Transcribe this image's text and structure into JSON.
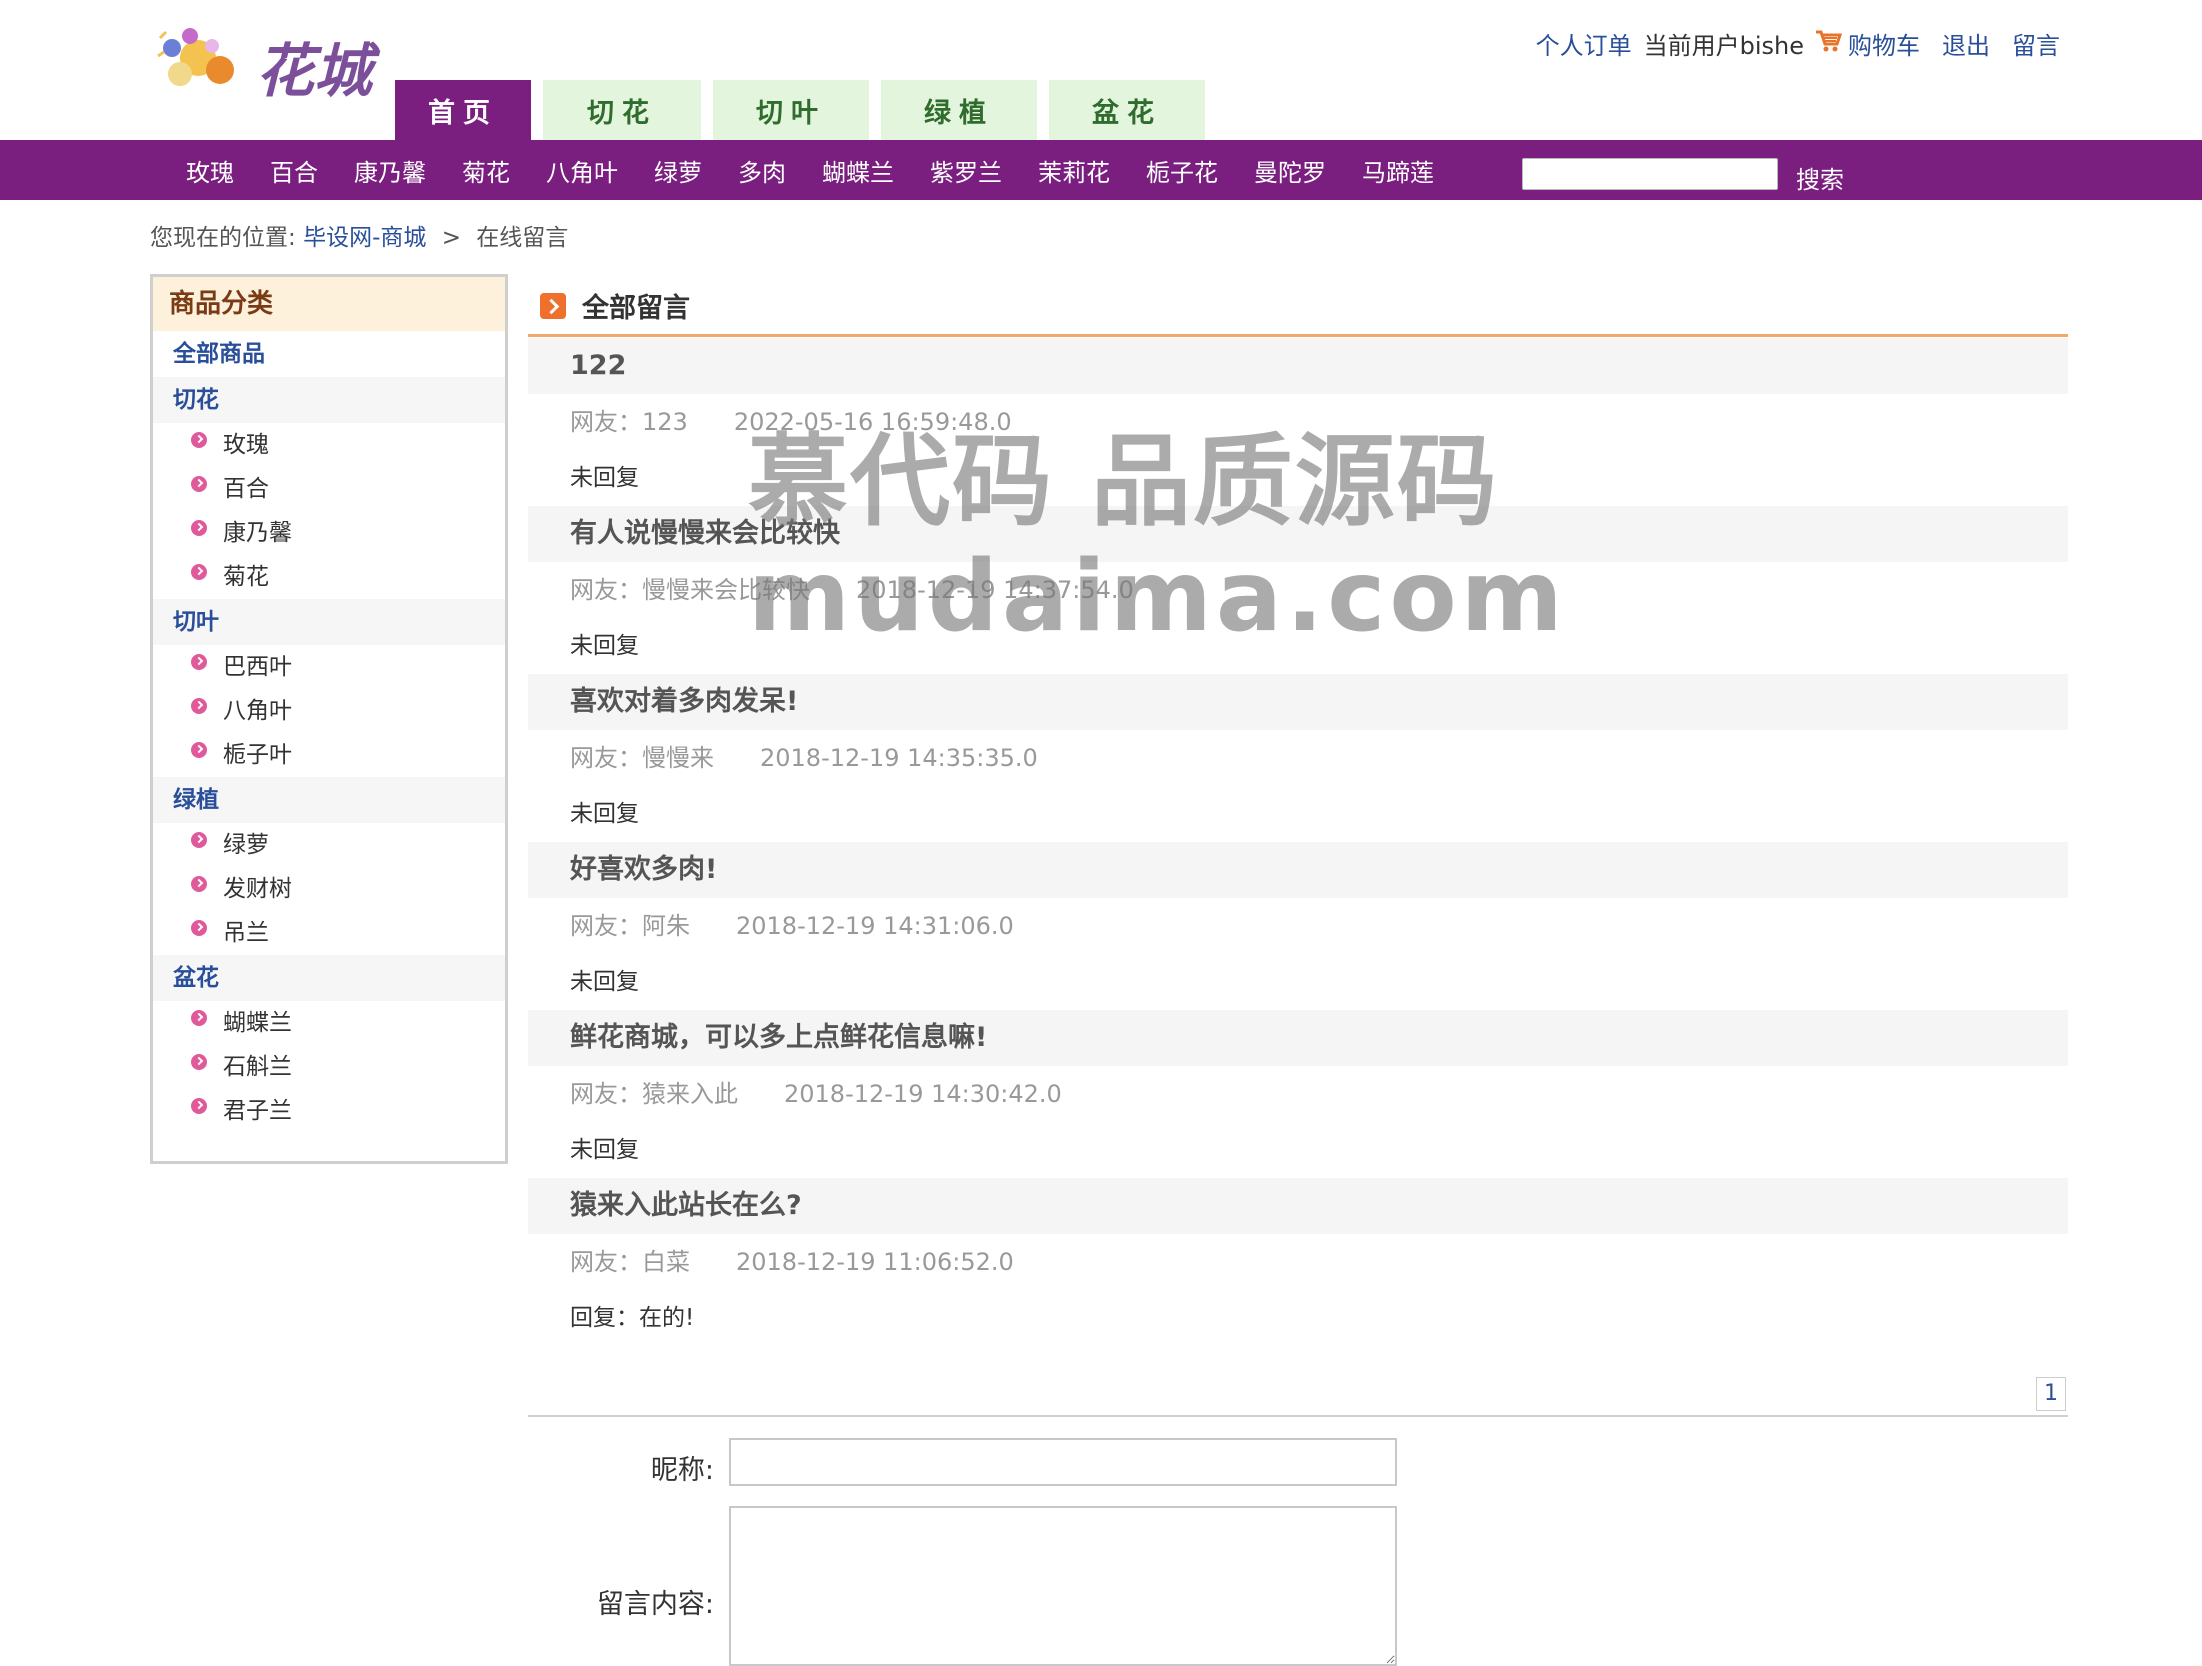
{
  "header": {
    "logo_text": "花城",
    "top_links": {
      "orders": "个人订单",
      "current_user": "当前用户bishe",
      "cart": "购物车",
      "logout": "退出",
      "message": "留言"
    },
    "main_tabs": [
      {
        "label": "首页",
        "active": true
      },
      {
        "label": "切花",
        "active": false
      },
      {
        "label": "切叶",
        "active": false
      },
      {
        "label": "绿植",
        "active": false
      },
      {
        "label": "盆花",
        "active": false
      }
    ],
    "sub_nav": [
      "玫瑰",
      "百合",
      "康乃馨",
      "菊花",
      "八角叶",
      "绿萝",
      "多肉",
      "蝴蝶兰",
      "紫罗兰",
      "茉莉花",
      "栀子花",
      "曼陀罗",
      "马蹄莲"
    ],
    "search": {
      "value": "",
      "button": "搜索"
    }
  },
  "breadcrumb": {
    "prefix": "您现在的位置:",
    "link": "毕设网-商城",
    "separator": ">",
    "current": "在线留言"
  },
  "sidebar": {
    "title": "商品分类",
    "all": "全部商品",
    "categories": [
      {
        "name": "切花",
        "items": [
          "玫瑰",
          "百合",
          "康乃馨",
          "菊花"
        ]
      },
      {
        "name": "切叶",
        "items": [
          "巴西叶",
          "八角叶",
          "栀子叶"
        ]
      },
      {
        "name": "绿植",
        "items": [
          "绿萝",
          "发财树",
          "吊兰"
        ]
      },
      {
        "name": "盆花",
        "items": [
          "蝴蝶兰",
          "石斛兰",
          "君子兰"
        ]
      }
    ]
  },
  "main": {
    "section_title": "全部留言",
    "messages": [
      {
        "title": "122",
        "author": "网友：123",
        "date": "2022-05-16 16:59:48.0",
        "reply": "未回复"
      },
      {
        "title": "有人说慢慢来会比较快",
        "author": "网友：慢慢来会比较快",
        "date": "2018-12-19 14:37:54.0",
        "reply": "未回复"
      },
      {
        "title": "喜欢对着多肉发呆!",
        "author": "网友：慢慢来",
        "date": "2018-12-19 14:35:35.0",
        "reply": "未回复"
      },
      {
        "title": "好喜欢多肉!",
        "author": "网友：阿朱",
        "date": "2018-12-19 14:31:06.0",
        "reply": "未回复"
      },
      {
        "title": "鲜花商城，可以多上点鲜花信息嘛!",
        "author": "网友：猿来入此",
        "date": "2018-12-19 14:30:42.0",
        "reply": "未回复"
      },
      {
        "title": "猿来入此站长在么?",
        "author": "网友：白菜",
        "date": "2018-12-19 11:06:52.0",
        "reply": "回复：在的!"
      }
    ],
    "pager": {
      "current_page": "1"
    }
  },
  "form": {
    "nickname_label": "昵称:",
    "nickname_value": "",
    "content_label": "留言内容:",
    "content_value": ""
  },
  "watermark": {
    "line1": "慕代码 品质源码",
    "line2": "mudaima.com"
  },
  "colors": {
    "purple": "#7a1f7f",
    "tab_green_bg": "#e4f5dd",
    "link_blue": "#2a4f9a",
    "accent_orange": "#f2a86a"
  }
}
